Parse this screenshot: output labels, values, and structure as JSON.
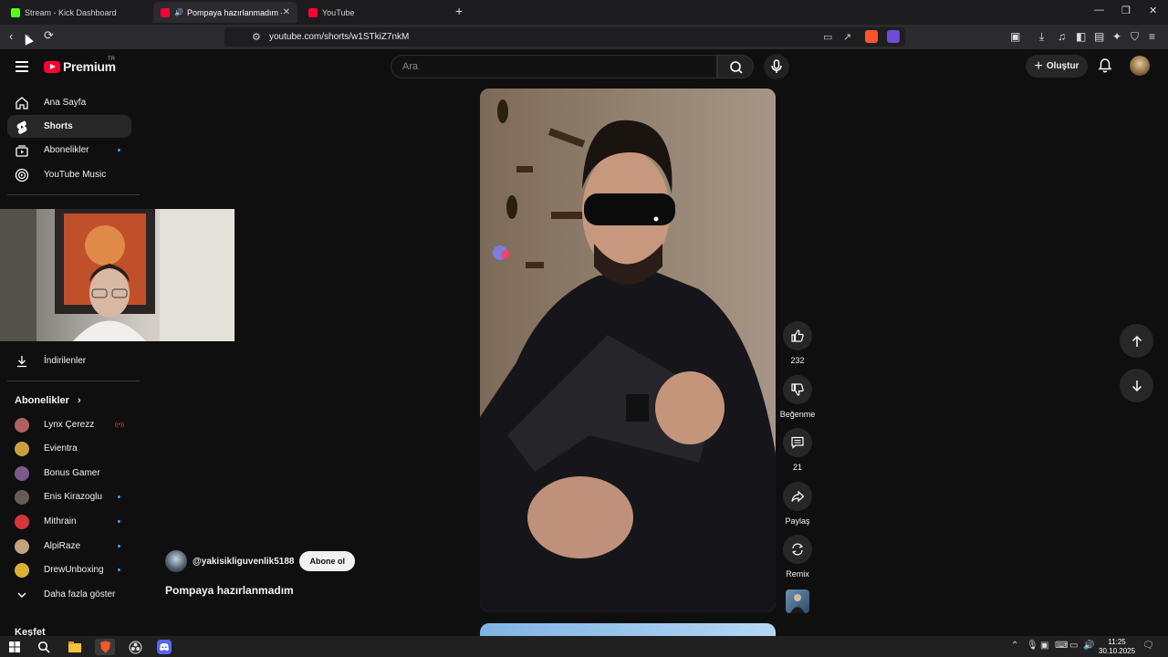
{
  "browser": {
    "tabs": [
      {
        "title": "Stream - Kick Dashboard",
        "favicon_color": "#53fc18"
      },
      {
        "title": "Pompaya hazırlanmadım - YouTube",
        "favicon_color": "#ff0033"
      },
      {
        "title": "YouTube",
        "favicon_color": "#ff0033"
      }
    ],
    "url": "youtube.com/shorts/w1STkiZ7nkM",
    "shield_badge": "34",
    "alert_badge": "1"
  },
  "header": {
    "logo_text": "Premium",
    "country_code": "TR",
    "search_placeholder": "Ara",
    "create_label": "Oluştur"
  },
  "sidebar": {
    "main_items": [
      {
        "label": "Ana Sayfa",
        "icon": "home-icon"
      },
      {
        "label": "Shorts",
        "icon": "shorts-icon",
        "active": true
      },
      {
        "label": "Abonelikler",
        "icon": "subscriptions-icon"
      },
      {
        "label": "YouTube Music",
        "icon": "youtube-music-icon"
      }
    ],
    "downloads_label": "İndirilenler",
    "subscriptions_title": "Abonelikler",
    "channels": [
      {
        "name": "Lynx Çerezz",
        "color": "#b06060",
        "live": true
      },
      {
        "name": "Evientra",
        "color": "#c9a040"
      },
      {
        "name": "Bonus Gamer",
        "color": "#7a5a8a"
      },
      {
        "name": "Enis Kirazoglu",
        "color": "#6a5a55",
        "dot": true
      },
      {
        "name": "Mithrain",
        "color": "#d8343c",
        "dot": true
      },
      {
        "name": "AlpiRaze",
        "color": "#c4a27a",
        "dot": true
      },
      {
        "name": "DrewUnboxing",
        "color": "#d9b233",
        "dot": true
      }
    ],
    "show_more_label": "Daha fazla göster",
    "next_section_title": "Keşfet"
  },
  "short": {
    "channel_handle": "@yakisikliguvenlik5188",
    "subscribe_label": "Abone ol",
    "title": "Pompaya hazırlanmadım",
    "likes": "232",
    "dislike_label": "Beğenme",
    "comments": "21",
    "share_label": "Paylaş",
    "remix_label": "Remix"
  },
  "taskbar": {
    "time": "11:25",
    "date": "30.10.2025"
  }
}
